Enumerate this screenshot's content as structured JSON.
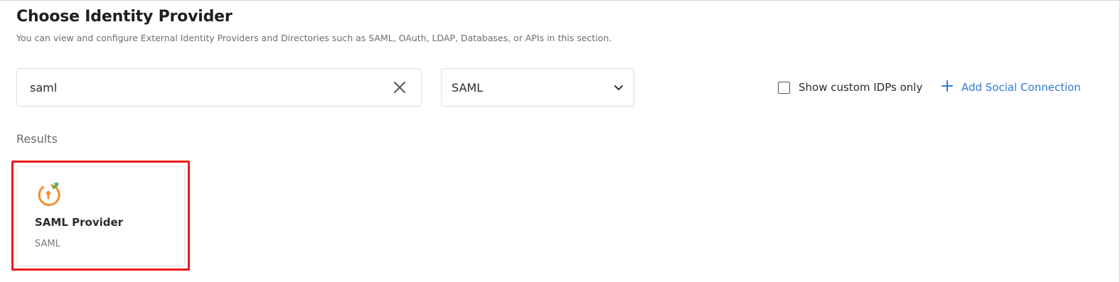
{
  "header": {
    "title": "Choose Identity Provider",
    "subtitle": "You can view and configure External Identity Providers and Directories such as SAML, OAuth, LDAP, Databases, or APIs in this section."
  },
  "search": {
    "value": "saml",
    "clear_icon": "close-icon"
  },
  "filter": {
    "selected": "SAML",
    "icon": "chevron-down-icon"
  },
  "toolbar": {
    "custom_only_label": "Show custom IDPs only",
    "custom_only_checked": false,
    "add_social_label": "Add Social Connection",
    "add_social_icon": "plus-icon"
  },
  "results": {
    "heading": "Results",
    "items": [
      {
        "name": "SAML Provider",
        "type": "SAML",
        "icon": "saml-provider-logo-icon",
        "highlighted": true
      }
    ]
  },
  "colors": {
    "accent": "#2e7bd8",
    "highlight": "#ee1b1b",
    "logo_orange": "#f0923a",
    "logo_green": "#4caf50"
  }
}
